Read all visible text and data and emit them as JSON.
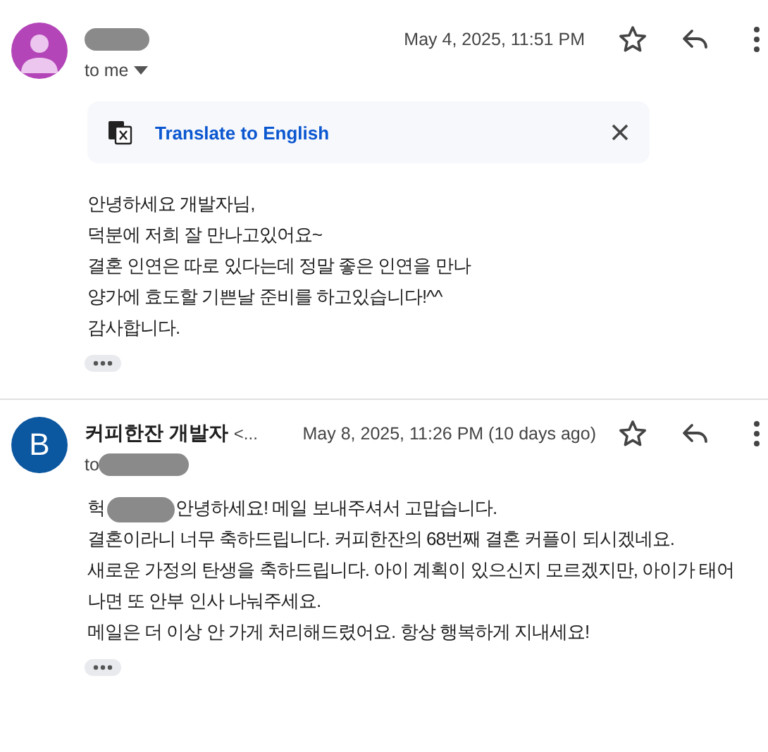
{
  "messages": [
    {
      "avatar": {
        "kind": "person",
        "color": "#b345b8"
      },
      "sender": {
        "redacted": true
      },
      "date": "May 4, 2025, 11:51 PM",
      "recipient": {
        "label": "to me",
        "redacted": false,
        "dropdown": true
      },
      "translate": {
        "label": "Translate to English"
      },
      "body": [
        {
          "text": "안녕하세요 개발자님,"
        },
        {
          "text": "덕분에 저희 잘 만나고있어요~"
        },
        {
          "text": "결혼 인연은 따로 있다는데 정말 좋은 인연을 만나"
        },
        {
          "text": "양가에 효도할 기쁜날 준비를 하고있습니다!^^"
        },
        {
          "text": "감사합니다."
        }
      ]
    },
    {
      "avatar": {
        "kind": "letter",
        "letter": "B",
        "color": "#0b57a0"
      },
      "sender": {
        "name": "커피한잔 개발자",
        "suffix": "<...",
        "redacted": false
      },
      "date": "May 8, 2025, 11:26 PM (10 days ago)",
      "recipient": {
        "label": "to",
        "redacted": true,
        "dropdown": false
      },
      "body": [
        {
          "prefix": "헉",
          "redacted": true,
          "text": "안녕하세요! 메일 보내주셔서 고맙습니다."
        },
        {
          "text": "결혼이라니 너무 축하드립니다. 커피한잔의 68번째 결혼 커플이 되시겠네요."
        },
        {
          "text": "새로운 가정의 탄생을 축하드립니다. 아이 계획이 있으신지 모르겠지만, 아이가 태어"
        },
        {
          "text": "나면 또 안부 인사 나눠주세요."
        },
        {
          "text": "메일은 더 이상 안 가게 처리해드렸어요. 항상 행복하게 지내세요!"
        }
      ]
    }
  ]
}
